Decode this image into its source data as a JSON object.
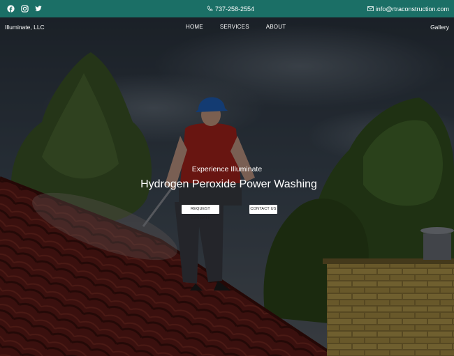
{
  "topbar": {
    "phone": "737-258-2554",
    "email": "info@rtraconstruction.com",
    "social": [
      "facebook-icon",
      "instagram-icon",
      "twitter-icon"
    ],
    "background": "#1b6f66"
  },
  "nav": {
    "brand": "Illuminate, LLC",
    "items": [
      "HOME",
      "SERVICES",
      "ABOUT"
    ],
    "right_link": "Gallery"
  },
  "hero": {
    "eyebrow": "Experience Illuminate",
    "headline": "Hydrogen Peroxide Power Washing",
    "buttons": {
      "estimate": "REQUEST ESTIMATE",
      "contact": "CONTACT US"
    }
  }
}
